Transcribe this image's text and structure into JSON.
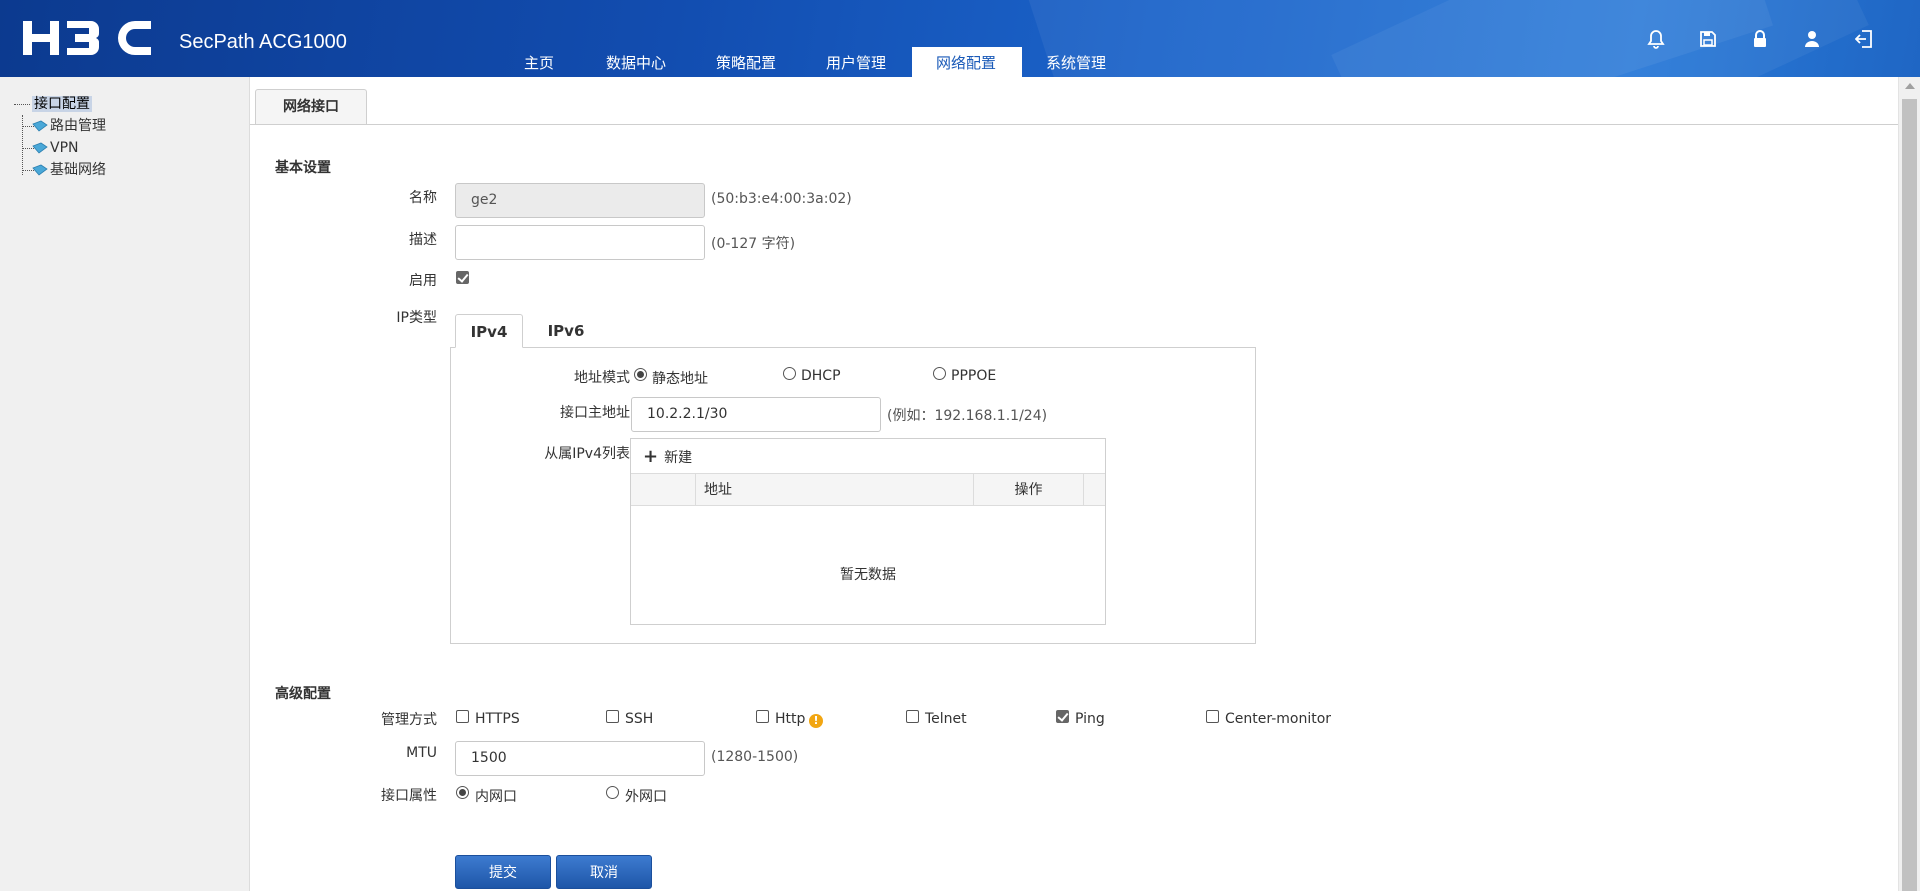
{
  "header": {
    "logo_text": "H3C",
    "product": "SecPath ACG1000",
    "nav": [
      {
        "label": "主页"
      },
      {
        "label": "数据中心"
      },
      {
        "label": "策略配置"
      },
      {
        "label": "用户管理"
      },
      {
        "label": "网络配置",
        "active": true
      },
      {
        "label": "系统管理"
      }
    ],
    "icons": [
      "bell-icon",
      "save-icon",
      "lock-icon",
      "user-icon",
      "logout-icon"
    ]
  },
  "sidebar": {
    "root": "接口配置",
    "items": [
      {
        "label": "路由管理"
      },
      {
        "label": "VPN"
      },
      {
        "label": "基础网络"
      }
    ]
  },
  "page_tab": "网络接口",
  "basic": {
    "title": "基本设置",
    "name_label": "名称",
    "name_value": "ge2",
    "mac": "(50:b3:e4:00:3a:02)",
    "desc_label": "描述",
    "desc_value": "",
    "desc_hint": "(0-127 字符)",
    "enable_label": "启用",
    "enabled": true,
    "ip_type_label": "IP类型",
    "ip_tabs": [
      "IPv4",
      "IPv6"
    ],
    "addr_mode_label": "地址模式",
    "addr_modes": [
      "静态地址",
      "DHCP",
      "PPPOE"
    ],
    "addr_mode_selected": "静态地址",
    "main_ip_label": "接口主地址",
    "main_ip_value": "10.2.2.1/30",
    "main_ip_hint": "(例如：192.168.1.1/24)",
    "sub_list_label": "从属IPv4列表",
    "new_label": "新建",
    "col_addr": "地址",
    "col_op": "操作",
    "empty_text": "暂无数据"
  },
  "advanced": {
    "title": "高级配置",
    "mgmt_label": "管理方式",
    "mgmt_options": [
      {
        "label": "HTTPS",
        "checked": false
      },
      {
        "label": "SSH",
        "checked": false
      },
      {
        "label": "Http",
        "checked": false,
        "warning": true
      },
      {
        "label": "Telnet",
        "checked": false
      },
      {
        "label": "Ping",
        "checked": true
      },
      {
        "label": "Center-monitor",
        "checked": false
      }
    ],
    "mtu_label": "MTU",
    "mtu_value": "1500",
    "mtu_hint": "(1280-1500)",
    "attr_label": "接口属性",
    "attr_options": [
      "内网口",
      "外网口"
    ],
    "attr_selected": "内网口"
  },
  "buttons": {
    "submit": "提交",
    "cancel": "取消"
  }
}
